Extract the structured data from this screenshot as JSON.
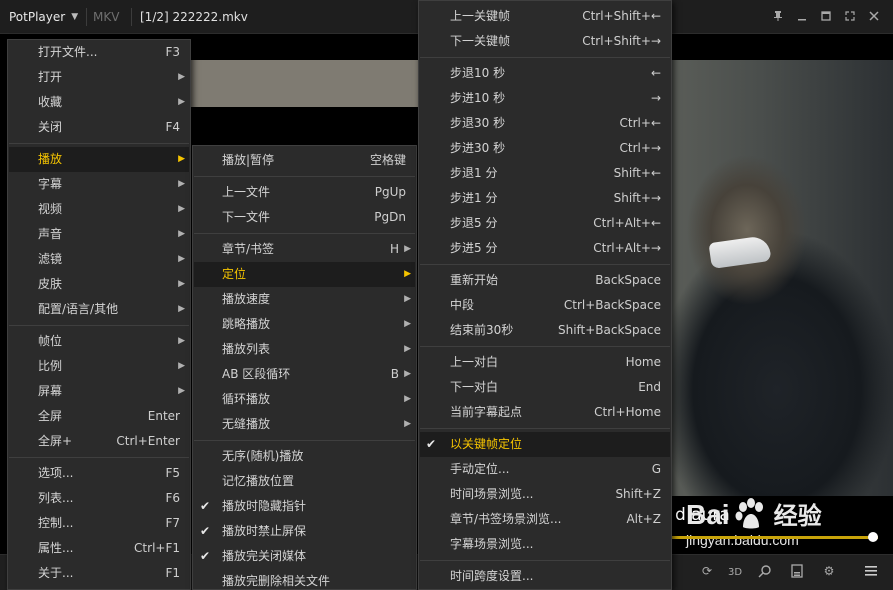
{
  "titlebar": {
    "app": "PotPlayer",
    "format": "MKV",
    "file": "[1/2] 222222.mkv"
  },
  "video": {
    "subtitle": "d aura"
  },
  "watermark": {
    "brand_left": "Bai",
    "brand_right": "经验",
    "url": "jingyan.baidu.com"
  },
  "menu_main": [
    {
      "label": "打开文件...",
      "shortcut": "F3"
    },
    {
      "label": "打开",
      "submenu": true
    },
    {
      "label": "收藏",
      "submenu": true
    },
    {
      "label": "关闭",
      "shortcut": "F4"
    },
    {
      "label": "播放",
      "submenu": true,
      "active": true
    },
    {
      "label": "字幕",
      "submenu": true
    },
    {
      "label": "视频",
      "submenu": true
    },
    {
      "label": "声音",
      "submenu": true
    },
    {
      "label": "滤镜",
      "submenu": true
    },
    {
      "label": "皮肤",
      "submenu": true
    },
    {
      "label": "配置/语言/其他",
      "submenu": true
    },
    {
      "label": "帧位",
      "submenu": true
    },
    {
      "label": "比例",
      "submenu": true
    },
    {
      "label": "屏幕",
      "submenu": true
    },
    {
      "label": "全屏",
      "shortcut": "Enter"
    },
    {
      "label": "全屏+",
      "shortcut": "Ctrl+Enter"
    },
    {
      "label": "选项...",
      "shortcut": "F5"
    },
    {
      "label": "列表...",
      "shortcut": "F6"
    },
    {
      "label": "控制...",
      "shortcut": "F7"
    },
    {
      "label": "属性...",
      "shortcut": "Ctrl+F1"
    },
    {
      "label": "关于...",
      "shortcut": "F1"
    }
  ],
  "menu_play": [
    {
      "label": "播放|暂停",
      "shortcut": "空格键"
    },
    {
      "label": "上一文件",
      "shortcut": "PgUp"
    },
    {
      "label": "下一文件",
      "shortcut": "PgDn"
    },
    {
      "label": "章节/书签",
      "shortcut": "H",
      "submenu": true
    },
    {
      "label": "定位",
      "submenu": true,
      "active": true
    },
    {
      "label": "播放速度",
      "submenu": true
    },
    {
      "label": "跳略播放",
      "submenu": true
    },
    {
      "label": "播放列表",
      "submenu": true
    },
    {
      "label": "AB 区段循环",
      "shortcut": "B",
      "submenu": true
    },
    {
      "label": "循环播放",
      "submenu": true
    },
    {
      "label": "无缝播放",
      "submenu": true
    },
    {
      "label": "无序(随机)播放"
    },
    {
      "label": "记忆播放位置"
    },
    {
      "label": "播放时隐藏指针",
      "checked": true
    },
    {
      "label": "播放时禁止屏保",
      "checked": true
    },
    {
      "label": "播放完关闭媒体",
      "checked": true
    },
    {
      "label": "播放完删除相关文件"
    }
  ],
  "menu_seek": [
    {
      "label": "上一关键帧",
      "shortcut": "Ctrl+Shift+←"
    },
    {
      "label": "下一关键帧",
      "shortcut": "Ctrl+Shift+→"
    },
    {
      "label": "步退10 秒",
      "shortcut": "←"
    },
    {
      "label": "步进10 秒",
      "shortcut": "→"
    },
    {
      "label": "步退30 秒",
      "shortcut": "Ctrl+←"
    },
    {
      "label": "步进30 秒",
      "shortcut": "Ctrl+→"
    },
    {
      "label": "步退1 分",
      "shortcut": "Shift+←"
    },
    {
      "label": "步进1 分",
      "shortcut": "Shift+→"
    },
    {
      "label": "步退5 分",
      "shortcut": "Ctrl+Alt+←"
    },
    {
      "label": "步进5 分",
      "shortcut": "Ctrl+Alt+→"
    },
    {
      "label": "重新开始",
      "shortcut": "BackSpace"
    },
    {
      "label": "中段",
      "shortcut": "Ctrl+BackSpace"
    },
    {
      "label": "结束前30秒",
      "shortcut": "Shift+BackSpace"
    },
    {
      "label": "上一对白",
      "shortcut": "Home"
    },
    {
      "label": "下一对白",
      "shortcut": "End"
    },
    {
      "label": "当前字幕起点",
      "shortcut": "Ctrl+Home"
    },
    {
      "label": "以关键帧定位",
      "checked": true,
      "active": true
    },
    {
      "label": "手动定位...",
      "shortcut": "G"
    },
    {
      "label": "时间场景浏览...",
      "shortcut": "Shift+Z"
    },
    {
      "label": "章节/书签场景浏览...",
      "shortcut": "Alt+Z"
    },
    {
      "label": "字幕场景浏览..."
    },
    {
      "label": "时间跨度设置..."
    }
  ],
  "colors": {
    "accent": "#f5c400",
    "menu_bg": "#2b2b2b",
    "active_bg": "#1d1d1d"
  }
}
